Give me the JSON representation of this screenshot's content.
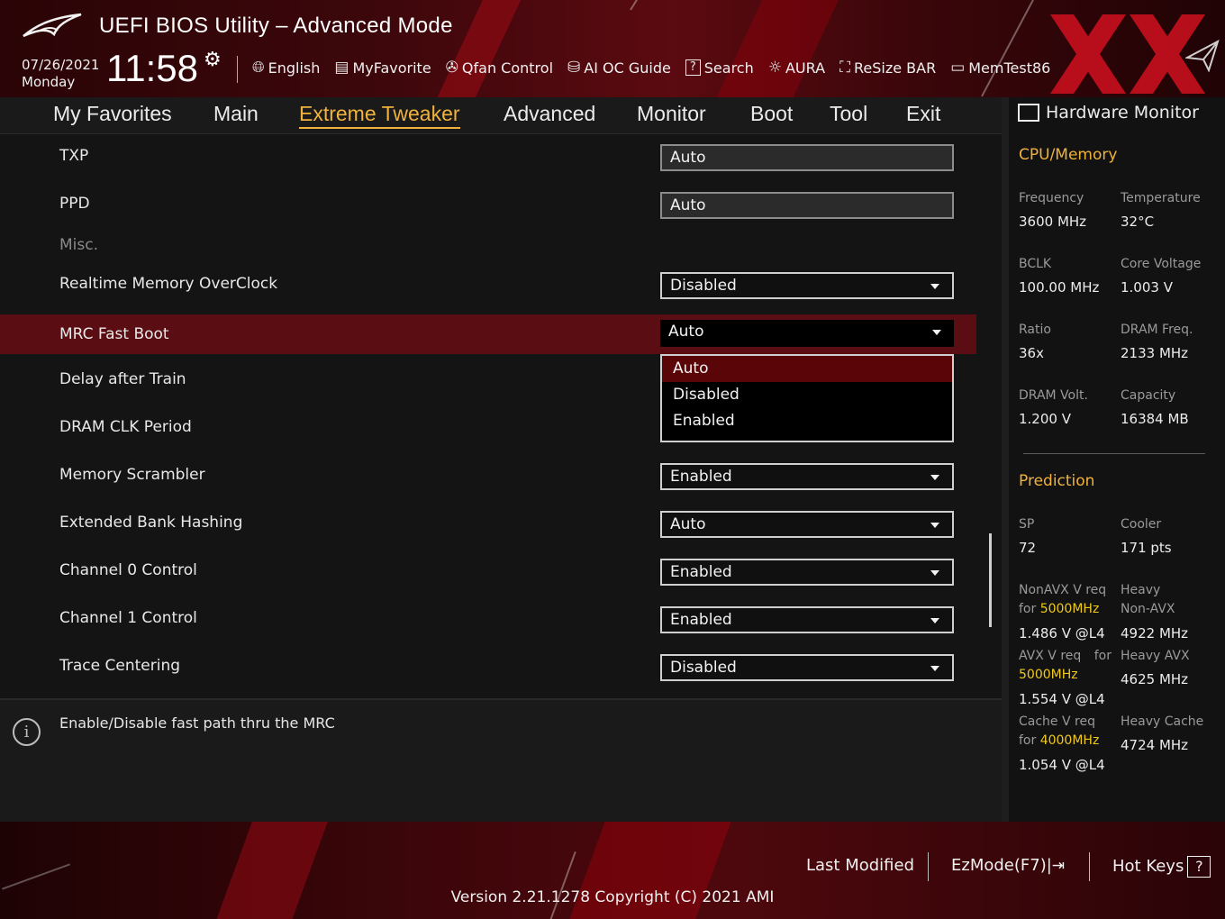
{
  "header": {
    "title": "UEFI BIOS Utility – Advanced Mode",
    "date": "07/26/2021",
    "day": "Monday",
    "time": "11:58",
    "toolbar": [
      {
        "label": "English",
        "icon": "globe-icon"
      },
      {
        "label": "MyFavorite",
        "icon": "favorite-icon"
      },
      {
        "label": "Qfan Control",
        "icon": "fan-icon"
      },
      {
        "label": "AI OC Guide",
        "icon": "ai-chip-icon"
      },
      {
        "label": "Search",
        "icon": "search-icon"
      },
      {
        "label": "AURA",
        "icon": "aura-icon"
      },
      {
        "label": "ReSize BAR",
        "icon": "resize-bar-icon"
      },
      {
        "label": "MemTest86",
        "icon": "memory-icon"
      }
    ]
  },
  "nav": {
    "tabs": [
      "My Favorites",
      "Main",
      "Extreme Tweaker",
      "Advanced",
      "Monitor",
      "Boot",
      "Tool",
      "Exit"
    ],
    "active": "Extreme Tweaker"
  },
  "settings": [
    {
      "label": "TXP",
      "value": "Auto",
      "kind": "text"
    },
    {
      "label": "PPD",
      "value": "Auto",
      "kind": "text"
    },
    {
      "label": "Misc.",
      "kind": "section"
    },
    {
      "label": "Realtime Memory OverClock",
      "value": "Disabled",
      "kind": "select"
    },
    {
      "label": "MRC Fast Boot",
      "value": "Auto",
      "kind": "select",
      "selected": true
    },
    {
      "label": "Delay after Train",
      "kind": "select"
    },
    {
      "label": "DRAM CLK Period",
      "kind": "select"
    },
    {
      "label": "Memory Scrambler",
      "value": "Enabled",
      "kind": "select"
    },
    {
      "label": "Extended Bank Hashing",
      "value": "Auto",
      "kind": "select"
    },
    {
      "label": "Channel 0 Control",
      "value": "Enabled",
      "kind": "select"
    },
    {
      "label": "Channel 1 Control",
      "value": "Enabled",
      "kind": "select"
    },
    {
      "label": "Trace Centering",
      "value": "Disabled",
      "kind": "select"
    }
  ],
  "dropdown": {
    "options": [
      "Auto",
      "Disabled",
      "Enabled"
    ],
    "highlighted": "Auto"
  },
  "help": {
    "text": "Enable/Disable fast path thru the MRC"
  },
  "hardware_monitor": {
    "title": "Hardware Monitor",
    "cpu_memory": {
      "heading": "CPU/Memory",
      "frequency_label": "Frequency",
      "frequency": "3600 MHz",
      "temperature_label": "Temperature",
      "temperature": "32°C",
      "bclk_label": "BCLK",
      "bclk": "100.00 MHz",
      "core_voltage_label": "Core Voltage",
      "core_voltage": "1.003 V",
      "ratio_label": "Ratio",
      "ratio": "36x",
      "dram_freq_label": "DRAM Freq.",
      "dram_freq": "2133 MHz",
      "dram_volt_label": "DRAM Volt.",
      "dram_volt": "1.200 V",
      "capacity_label": "Capacity",
      "capacity": "16384 MB"
    },
    "prediction": {
      "heading": "Prediction",
      "sp_label": "SP",
      "sp": "72",
      "cooler_label": "Cooler",
      "cooler": "171 pts",
      "nonavx_label_1": "NonAVX V req",
      "nonavx_label_2": "for",
      "nonavx_freq": "5000MHz",
      "nonavx_v": "1.486 V @L4",
      "heavy_nonavx_label_1": "Heavy",
      "heavy_nonavx_label_2": "Non-AVX",
      "heavy_nonavx": "4922 MHz",
      "avx_label_1": "AVX V req",
      "avx_label_2": "for",
      "avx_freq": "5000MHz",
      "avx_v": "1.554 V @L4",
      "heavy_avx_label": "Heavy AVX",
      "heavy_avx": "4625 MHz",
      "cache_label_1": "Cache V req",
      "cache_label_2": "for",
      "cache_freq": "4000MHz",
      "cache_v": "1.054 V @L4",
      "heavy_cache_label": "Heavy Cache",
      "heavy_cache": "4724 MHz"
    }
  },
  "footer": {
    "last_modified": "Last Modified",
    "ezmode": "EzMode(F7)|",
    "hotkeys": "Hot Keys",
    "hotkeys_glyph": "?",
    "version": "Version 2.21.1278 Copyright (C) 2021 AMI"
  },
  "colors": {
    "accent": "#f0b23c",
    "highlight_yellow": "#f0c91c",
    "selected_row": "#5a0e14",
    "brand_red": "#c8101e"
  }
}
